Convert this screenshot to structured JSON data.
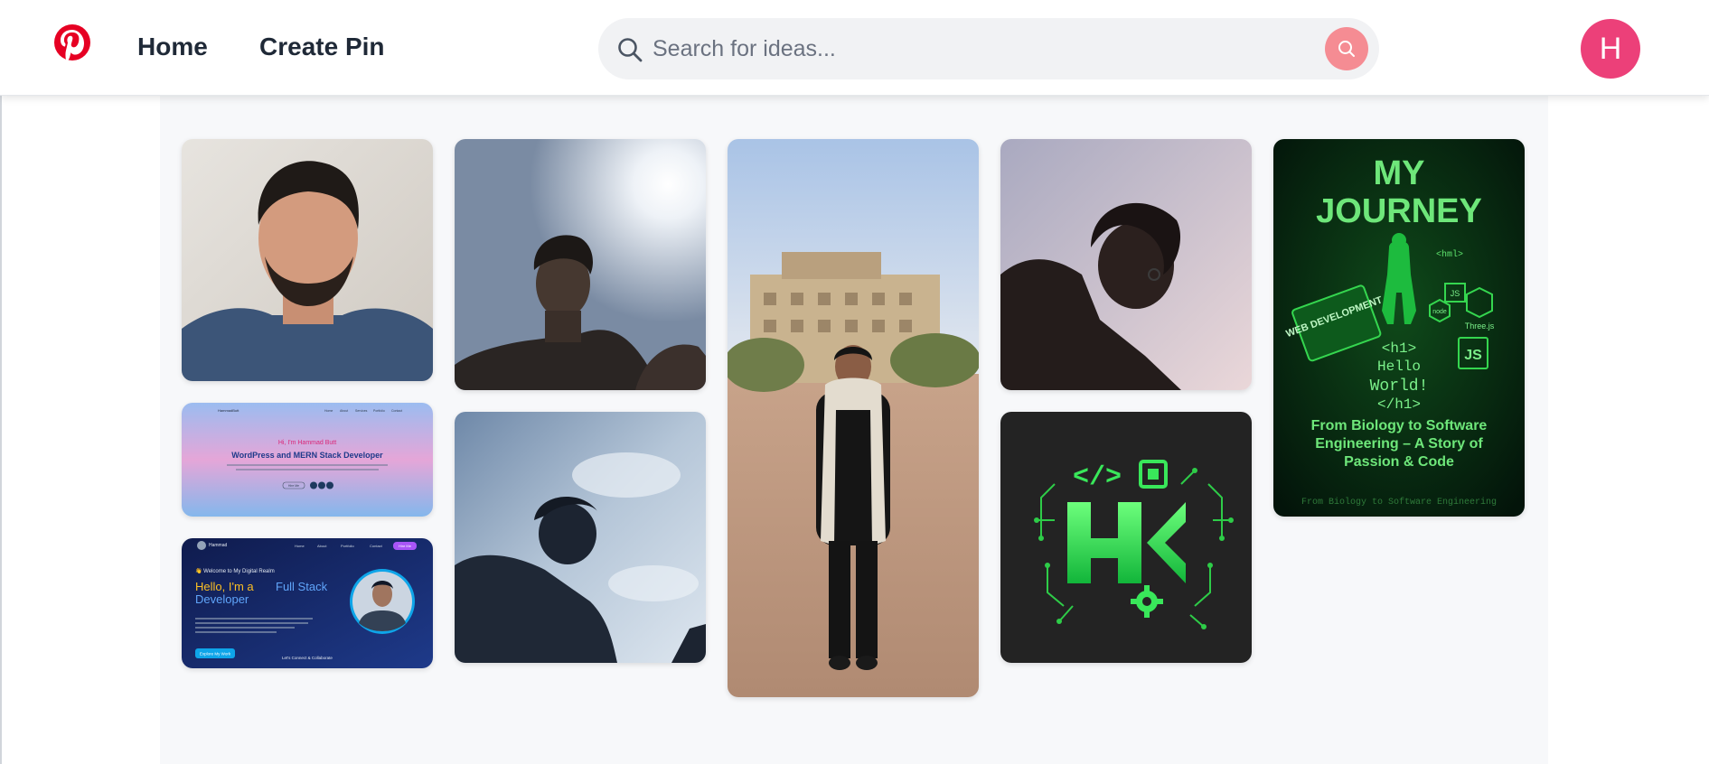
{
  "header": {
    "nav": {
      "home": "Home",
      "create_pin": "Create Pin"
    },
    "search": {
      "placeholder": "Search for ideas..."
    },
    "avatar": {
      "initial": "H",
      "color": "#ec4079"
    },
    "brand_color": "#e60023"
  },
  "pins": [
    {
      "id": "pin-portrait-man",
      "icon": "photo",
      "description": "portrait photo"
    },
    {
      "id": "pin-portfolio-pink",
      "icon": "screenshot",
      "texts": {
        "brand": "HammadButt",
        "nav": [
          "Home",
          "About",
          "Services",
          "Portfolio",
          "Contact"
        ],
        "greeting": "Hi, I'm Hammad Butt",
        "title": "WordPress and MERN Stack Developer",
        "button": "Hire Me"
      }
    },
    {
      "id": "pin-portfolio-dark",
      "icon": "screenshot",
      "texts": {
        "brand": "Hammad",
        "nav": [
          "Home",
          "About",
          "Portfolio",
          "Contact"
        ],
        "nav_button": "Hire Me",
        "welcome": "👋 Welcome to My Digital Realm",
        "hello": "Hello, I'm a",
        "role": "Full Stack",
        "role2": "Developer",
        "button": "Explore My Work",
        "connect": "Let's Connect & Collaborate"
      }
    },
    {
      "id": "pin-silhouette-sun",
      "icon": "photo"
    },
    {
      "id": "pin-silhouette-clouds",
      "icon": "photo"
    },
    {
      "id": "pin-man-standing",
      "icon": "photo"
    },
    {
      "id": "pin-man-looking-down",
      "icon": "photo"
    },
    {
      "id": "pin-hk-logo",
      "icon": "logo",
      "texts": {
        "code_tag": "</>"
      }
    },
    {
      "id": "pin-my-journey",
      "icon": "poster",
      "texts": {
        "title1": "MY",
        "title2": "JOURNEY",
        "html_tag": "<hml>",
        "book": "WEB DEVELOPMENT",
        "code1": "<h1>",
        "code2": "Hello",
        "code3": "World!",
        "code4": "</h1>",
        "node": "node",
        "js_small": "JS",
        "three": "Three.js",
        "js_big": "JS",
        "subtitle": "From Biology to Software Engineering – A Story of Passion & Code",
        "footer": "From Biology to Software Engineering"
      }
    }
  ]
}
